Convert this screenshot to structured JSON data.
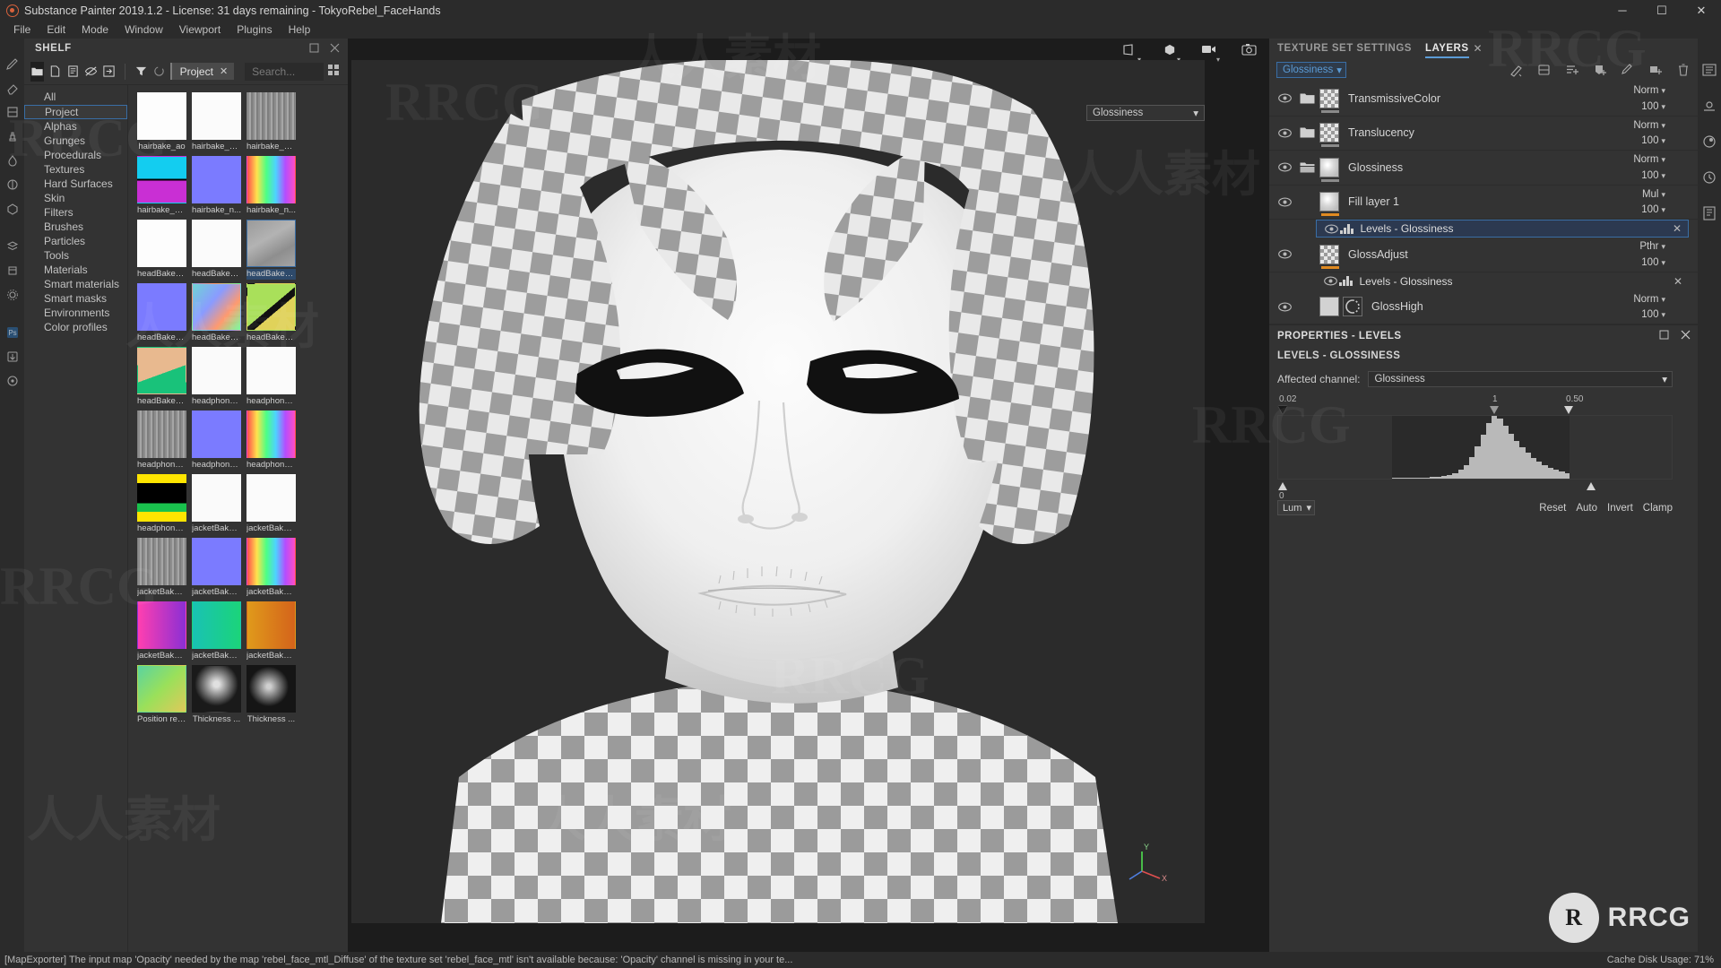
{
  "window": {
    "title": "Substance Painter 2019.1.2 - License: 31 days remaining - TokyoRebel_FaceHands",
    "minimize": "─",
    "maximize": "☐",
    "close": "✕"
  },
  "menubar": {
    "items": [
      "File",
      "Edit",
      "Mode",
      "Window",
      "Viewport",
      "Plugins",
      "Help"
    ]
  },
  "shelf": {
    "title": "SHELF",
    "filter_chip": "Project",
    "filter_chip_close": "✕",
    "search_placeholder": "Search...",
    "categories": [
      "All",
      "Project",
      "Alphas",
      "Grunges",
      "Procedurals",
      "Textures",
      "Hard Surfaces",
      "Skin",
      "Filters",
      "Brushes",
      "Particles",
      "Tools",
      "Materials",
      "Smart materials",
      "Smart masks",
      "Environments",
      "Color profiles"
    ],
    "selected_category": "Project",
    "thumbnails": [
      {
        "label": "hairbake_ao",
        "style": "sketch-white"
      },
      {
        "label": "hairbake_co...",
        "style": "plain-white"
      },
      {
        "label": "hairbake_cu...",
        "style": "grey-noise"
      },
      {
        "label": "hairbake_gr...",
        "style": "id-colors"
      },
      {
        "label": "hairbake_n...",
        "style": "normal-blue"
      },
      {
        "label": "hairbake_n...",
        "style": "rainbow"
      },
      {
        "label": "headBake_ao",
        "style": "sketch-white"
      },
      {
        "label": "headBake_c...",
        "style": "plain-white"
      },
      {
        "label": "headBake_c...",
        "style": "grey-curv",
        "selected": true
      },
      {
        "label": "headBake_n...",
        "style": "normal-blue"
      },
      {
        "label": "headBake_n...",
        "style": "normal-face"
      },
      {
        "label": "headBake_...",
        "style": "id-green"
      },
      {
        "label": "headBake_v...",
        "style": "skin-face"
      },
      {
        "label": "headphone...",
        "style": "line-white"
      },
      {
        "label": "headphone...",
        "style": "plain-white"
      },
      {
        "label": "headphone...",
        "style": "grey-noise"
      },
      {
        "label": "headphone...",
        "style": "normal-blue"
      },
      {
        "label": "headphone...",
        "style": "rainbow"
      },
      {
        "label": "headphone...",
        "style": "id-primary"
      },
      {
        "label": "jacketBake_...",
        "style": "line-white"
      },
      {
        "label": "jacketBake_...",
        "style": "plain-white"
      },
      {
        "label": "jacketBake_...",
        "style": "grey-noise"
      },
      {
        "label": "jacketBake_...",
        "style": "normal-blue"
      },
      {
        "label": "jacketBake_...",
        "style": "rainbow"
      },
      {
        "label": "jacketBake_...",
        "style": "id-pink"
      },
      {
        "label": "jacketBake_...",
        "style": "id-teal"
      },
      {
        "label": "jacketBake_...",
        "style": "id-orange"
      },
      {
        "label": "Position reb...",
        "style": "position-map"
      },
      {
        "label": "Thickness ...",
        "style": "thickness-dark"
      },
      {
        "label": "Thickness ...",
        "style": "thickness-dark2"
      }
    ]
  },
  "viewport": {
    "channel_selector": "Glossiness"
  },
  "right_panel": {
    "tabs": [
      {
        "label": "TEXTURE SET SETTINGS",
        "active": false
      },
      {
        "label": "LAYERS",
        "active": true
      }
    ],
    "tab_close": "✕",
    "texture_set_select": "Glossiness",
    "layers": [
      {
        "name": "TransmissiveColor",
        "blend": "Norm",
        "opacity": "100",
        "type": "folder",
        "thumb": "checker",
        "underline": "grey"
      },
      {
        "name": "Translucency",
        "blend": "Norm",
        "opacity": "100",
        "type": "folder",
        "thumb": "checker",
        "underline": "grey"
      },
      {
        "name": "Glossiness",
        "blend": "Norm",
        "opacity": "100",
        "type": "folder-open",
        "thumb": "gloss",
        "underline": "grey"
      },
      {
        "name": "Fill layer 1",
        "blend": "Mul",
        "opacity": "100",
        "type": "layer",
        "thumb": "gloss",
        "underline": "orange",
        "effects": [
          {
            "name": "Levels - Glossiness",
            "selected": true,
            "close": "✕"
          }
        ]
      },
      {
        "name": "GlossAdjust",
        "blend": "Pthr",
        "opacity": "100",
        "type": "layer",
        "thumb": "checker",
        "underline": "orange",
        "effects": [
          {
            "name": "Levels - Glossiness",
            "selected": false,
            "close": "✕"
          }
        ]
      },
      {
        "name": "GlossHigh",
        "blend": "Norm",
        "opacity": "100",
        "type": "layer-mask",
        "thumb": "plain",
        "underline": "none"
      }
    ]
  },
  "properties": {
    "header_title": "PROPERTIES - LEVELS",
    "sub_title": "LEVELS - GLOSSINESS",
    "affected_channel_label": "Affected channel:",
    "affected_channel_value": "Glossiness",
    "input_low_label": "0.02",
    "input_mid_label": "1",
    "input_high_label": "0.50",
    "output_low_label": "0",
    "mode_select": "Lum",
    "buttons": [
      "Reset",
      "Auto",
      "Invert",
      "Clamp"
    ],
    "histogram": [
      1,
      1,
      1,
      1,
      1,
      1,
      1,
      1,
      1,
      1,
      1,
      1,
      1,
      1,
      1,
      1,
      1,
      1,
      1,
      1,
      1,
      1,
      1,
      1,
      2,
      2,
      2,
      3,
      3,
      4,
      6,
      9,
      14,
      22,
      34,
      52,
      70,
      88,
      100,
      96,
      85,
      72,
      60,
      50,
      41,
      33,
      27,
      21,
      17,
      14,
      11,
      9,
      7,
      6,
      5,
      4,
      3,
      3,
      2,
      2,
      2,
      1,
      1,
      1,
      1,
      1,
      1,
      1,
      1,
      1
    ]
  },
  "statusbar": {
    "message": "[MapExporter] The input map 'Opacity' needed by the map 'rebel_face_mtl_Diffuse' of the texture set 'rebel_face_mtl' isn't available because: 'Opacity' channel is missing in your te...",
    "cache": "Cache Disk Usage: 71%"
  },
  "watermarks": {
    "brand": "RRCG",
    "cn": "人人素材",
    "logo_letter": "R",
    "logo_text": "RRCG",
    "logo_sub": ""
  },
  "colors": {
    "accent": "#3a6ea5",
    "accent_text": "#5b9bd5",
    "panel": "#333333",
    "orange": "#e08a21"
  }
}
